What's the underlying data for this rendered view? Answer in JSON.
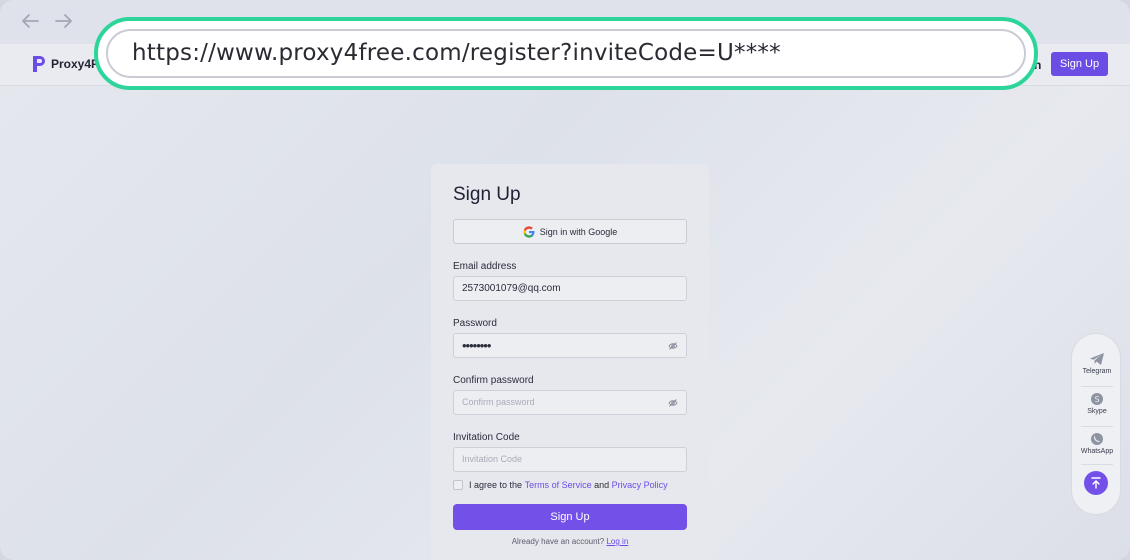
{
  "browser": {
    "back_icon": "arrow-left-icon",
    "forward_icon": "arrow-right-icon",
    "url": "https://www.proxy4free.com/register?inviteCode=U****"
  },
  "header": {
    "logo_text": "Proxy4Fr",
    "login_fragment": "n",
    "signup_label": "Sign Up",
    "accent": "#6b4de6"
  },
  "form": {
    "title": "Sign Up",
    "google_label": "Sign in with Google",
    "email_label": "Email address",
    "email_value": "2573001079@qq.com",
    "password_label": "Password",
    "password_value": "••••••••",
    "confirm_label": "Confirm password",
    "confirm_placeholder": "Confirm password",
    "invite_label": "Invitation Code",
    "invite_placeholder": "Invitation Code",
    "agree_prefix": "I agree to the",
    "terms_link": "Terms of Service",
    "agree_and": "and",
    "privacy_link": "Privacy Policy",
    "submit_label": "Sign Up",
    "have_account": "Already have an account?",
    "login_link": "Log in"
  },
  "contact": {
    "telegram": "Telegram",
    "skype": "Skype",
    "whatsapp": "WhatsApp"
  },
  "highlight_color": "#2ed59a"
}
